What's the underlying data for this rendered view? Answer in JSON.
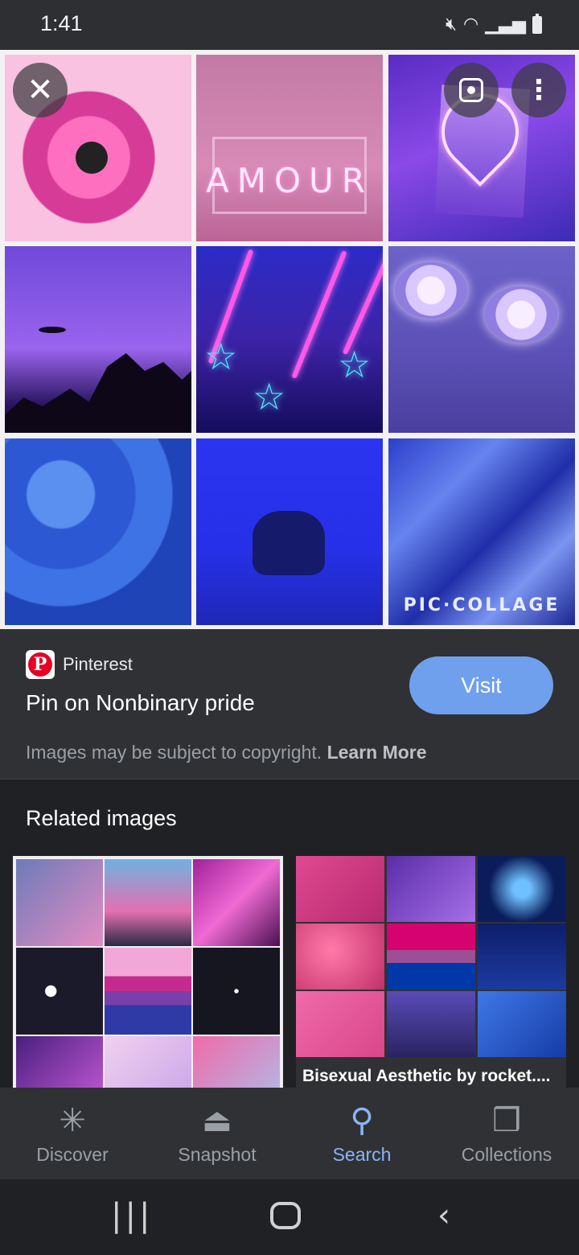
{
  "status_bar": {
    "time": "1:41"
  },
  "image_overlay": {
    "amour_text": "AMOUR",
    "pic_collage_text": "PIC·COLLAGE"
  },
  "info": {
    "source": "Pinterest",
    "title": "Pin on Nonbinary pride",
    "visit_label": "Visit",
    "copyright_text": "Images may be subject to copyright.",
    "learn_more": "Learn More"
  },
  "related": {
    "heading": "Related images",
    "items": [
      {
        "caption": ""
      },
      {
        "caption": "Bisexual Aesthetic by rocket...."
      }
    ]
  },
  "bottom_nav": [
    {
      "label": "Discover",
      "icon": "asterisk-icon"
    },
    {
      "label": "Snapshot",
      "icon": "snapshot-icon"
    },
    {
      "label": "Search",
      "icon": "search-icon",
      "active": true
    },
    {
      "label": "Collections",
      "icon": "bookmarks-icon"
    }
  ],
  "colors": {
    "accent": "#8ab4f8",
    "visit_button": "#6fa0ee",
    "background": "#202124"
  }
}
